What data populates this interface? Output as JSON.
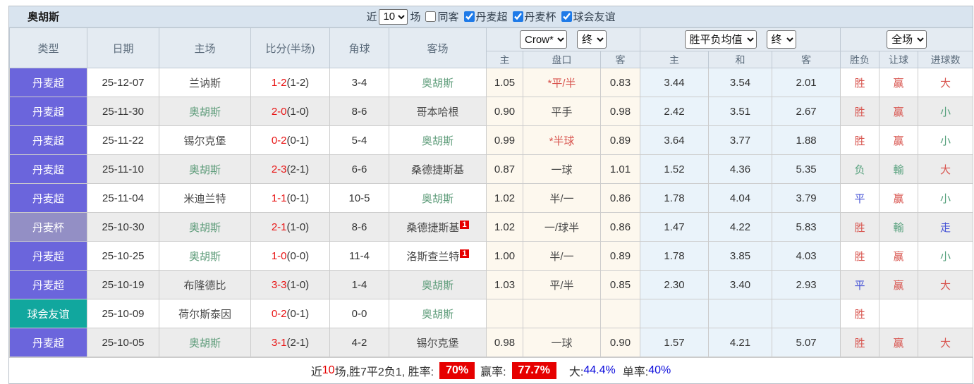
{
  "title_bar": {
    "team": "奥胡斯",
    "recent_label": "近",
    "recent_count": "10",
    "matches_label": "场",
    "filters": [
      {
        "label": "同客",
        "checked": false
      },
      {
        "label": "丹麦超",
        "checked": true,
        "checked_attr": "checked"
      },
      {
        "label": "丹麦杯",
        "checked": true,
        "checked_attr": "checked"
      },
      {
        "label": "球会友谊",
        "checked": true,
        "checked_attr": "checked"
      }
    ]
  },
  "table": {
    "main_headers": {
      "type": "类型",
      "date": "日期",
      "home": "主场",
      "score": "比分(半场)",
      "corners": "角球",
      "away": "客场"
    },
    "controls": {
      "company": "Crow*",
      "final1": "终",
      "avg": "胜平负均值",
      "final2": "终",
      "scope": "全场"
    },
    "sub_headers": {
      "odds_home": "主",
      "handicap": "盘口",
      "odds_away": "客",
      "avg_home": "主",
      "avg_draw": "和",
      "avg_away": "客",
      "result": "胜负",
      "handicap_result": "让球",
      "goals": "进球数"
    },
    "rows": [
      {
        "type": "丹麦超",
        "type_key": "league",
        "date": "25-12-07",
        "home": "兰讷斯",
        "home_color": "dark",
        "score": "1-2",
        "half": "(1-2)",
        "corners": "3-4",
        "away": "奥胡斯",
        "away_color": "focus",
        "away_badge": "",
        "odds_home": "1.05",
        "handicap": "*平/半",
        "handicap_color": "red",
        "odds_away": "0.83",
        "avg_home": "3.44",
        "avg_draw": "3.54",
        "avg_away": "2.01",
        "result": "胜",
        "result_color": "red",
        "handicap_result": "赢",
        "handicap_result_color": "red",
        "goals": "大",
        "goals_color": "red"
      },
      {
        "type": "丹麦超",
        "type_key": "league",
        "date": "25-11-30",
        "home": "奥胡斯",
        "home_color": "focus",
        "score": "2-0",
        "half": "(1-0)",
        "corners": "8-6",
        "away": "哥本哈根",
        "away_color": "dark",
        "away_badge": "",
        "odds_home": "0.90",
        "handicap": "平手",
        "handicap_color": "dark",
        "odds_away": "0.98",
        "avg_home": "2.42",
        "avg_draw": "3.51",
        "avg_away": "2.67",
        "result": "胜",
        "result_color": "red",
        "handicap_result": "赢",
        "handicap_result_color": "red",
        "goals": "小",
        "goals_color": "green"
      },
      {
        "type": "丹麦超",
        "type_key": "league",
        "date": "25-11-22",
        "home": "锡尔克堡",
        "home_color": "dark",
        "score": "0-2",
        "half": "(0-1)",
        "corners": "5-4",
        "away": "奥胡斯",
        "away_color": "focus",
        "away_badge": "",
        "odds_home": "0.99",
        "handicap": "*半球",
        "handicap_color": "red",
        "odds_away": "0.89",
        "avg_home": "3.64",
        "avg_draw": "3.77",
        "avg_away": "1.88",
        "result": "胜",
        "result_color": "red",
        "handicap_result": "赢",
        "handicap_result_color": "red",
        "goals": "小",
        "goals_color": "green"
      },
      {
        "type": "丹麦超",
        "type_key": "league",
        "date": "25-11-10",
        "home": "奥胡斯",
        "home_color": "focus",
        "score": "2-3",
        "half": "(2-1)",
        "corners": "6-6",
        "away": "桑德捷斯基",
        "away_color": "dark",
        "away_badge": "",
        "odds_home": "0.87",
        "handicap": "一球",
        "handicap_color": "dark",
        "odds_away": "1.01",
        "avg_home": "1.52",
        "avg_draw": "4.36",
        "avg_away": "5.35",
        "result": "负",
        "result_color": "green",
        "handicap_result": "輸",
        "handicap_result_color": "green",
        "goals": "大",
        "goals_color": "red"
      },
      {
        "type": "丹麦超",
        "type_key": "league",
        "date": "25-11-04",
        "home": "米迪兰特",
        "home_color": "dark",
        "score": "1-1",
        "half": "(0-1)",
        "corners": "10-5",
        "away": "奥胡斯",
        "away_color": "focus",
        "away_badge": "",
        "odds_home": "1.02",
        "handicap": "半/一",
        "handicap_color": "dark",
        "odds_away": "0.86",
        "avg_home": "1.78",
        "avg_draw": "4.04",
        "avg_away": "3.79",
        "result": "平",
        "result_color": "blue",
        "handicap_result": "赢",
        "handicap_result_color": "red",
        "goals": "小",
        "goals_color": "green"
      },
      {
        "type": "丹麦杯",
        "type_key": "cup",
        "date": "25-10-30",
        "home": "奥胡斯",
        "home_color": "focus",
        "score": "2-1",
        "half": "(1-0)",
        "corners": "8-6",
        "away": "桑德捷斯基",
        "away_color": "dark",
        "away_badge": "1",
        "odds_home": "1.02",
        "handicap": "一/球半",
        "handicap_color": "dark",
        "odds_away": "0.86",
        "avg_home": "1.47",
        "avg_draw": "4.22",
        "avg_away": "5.83",
        "result": "胜",
        "result_color": "red",
        "handicap_result": "輸",
        "handicap_result_color": "green",
        "goals": "走",
        "goals_color": "blue"
      },
      {
        "type": "丹麦超",
        "type_key": "league",
        "date": "25-10-25",
        "home": "奥胡斯",
        "home_color": "focus",
        "score": "1-0",
        "half": "(0-0)",
        "corners": "11-4",
        "away": "洛斯查兰特",
        "away_color": "dark",
        "away_badge": "1",
        "odds_home": "1.00",
        "handicap": "半/一",
        "handicap_color": "dark",
        "odds_away": "0.89",
        "avg_home": "1.78",
        "avg_draw": "3.85",
        "avg_away": "4.03",
        "result": "胜",
        "result_color": "red",
        "handicap_result": "赢",
        "handicap_result_color": "red",
        "goals": "小",
        "goals_color": "green"
      },
      {
        "type": "丹麦超",
        "type_key": "league",
        "date": "25-10-19",
        "home": "布隆德比",
        "home_color": "dark",
        "score": "3-3",
        "half": "(1-0)",
        "corners": "1-4",
        "away": "奥胡斯",
        "away_color": "focus",
        "away_badge": "",
        "odds_home": "1.03",
        "handicap": "平/半",
        "handicap_color": "dark",
        "odds_away": "0.85",
        "avg_home": "2.30",
        "avg_draw": "3.40",
        "avg_away": "2.93",
        "result": "平",
        "result_color": "blue",
        "handicap_result": "赢",
        "handicap_result_color": "red",
        "goals": "大",
        "goals_color": "red"
      },
      {
        "type": "球会友谊",
        "type_key": "friendly",
        "date": "25-10-09",
        "home": "荷尔斯泰因",
        "home_color": "dark",
        "score": "0-2",
        "half": "(0-1)",
        "corners": "0-0",
        "away": "奥胡斯",
        "away_color": "focus",
        "away_badge": "",
        "odds_home": "",
        "handicap": "",
        "handicap_color": "dark",
        "odds_away": "",
        "avg_home": "",
        "avg_draw": "",
        "avg_away": "",
        "result": "胜",
        "result_color": "red",
        "handicap_result": "",
        "handicap_result_color": "dark",
        "goals": "",
        "goals_color": "dark"
      },
      {
        "type": "丹麦超",
        "type_key": "league",
        "date": "25-10-05",
        "home": "奥胡斯",
        "home_color": "focus",
        "score": "3-1",
        "half": "(2-1)",
        "corners": "4-2",
        "away": "锡尔克堡",
        "away_color": "dark",
        "away_badge": "",
        "odds_home": "0.98",
        "handicap": "一球",
        "handicap_color": "dark",
        "odds_away": "0.90",
        "avg_home": "1.57",
        "avg_draw": "4.21",
        "avg_away": "5.07",
        "result": "胜",
        "result_color": "red",
        "handicap_result": "赢",
        "handicap_result_color": "red",
        "goals": "大",
        "goals_color": "red"
      }
    ]
  },
  "footer": {
    "prefix": "近",
    "count": "10",
    "stats": "场,胜7平2负1, 胜率:",
    "win_rate": "70%",
    "handicap_label": "赢率:",
    "handicap_rate": "77.7%",
    "big_label": "大:",
    "big_rate": "44.4%",
    "single_label": "单率:",
    "single_rate": "40%"
  },
  "colors": {
    "league_bg": "#6b65dc",
    "cup_bg": "#938fc5",
    "friendly_bg": "#11a79e",
    "focus_team_green": "#5e9c7a",
    "result_red": "#d8544e",
    "result_green": "#55a07c",
    "result_blue": "#4754d6",
    "score_red": "#e81414",
    "badge_red": "#e60000",
    "crow_col_bg": "#fdf8ee",
    "avg_col_bg": "#eaf3fa",
    "title_bar_bg": "#d9e4ef",
    "header_bg": "#e4ebf2"
  }
}
